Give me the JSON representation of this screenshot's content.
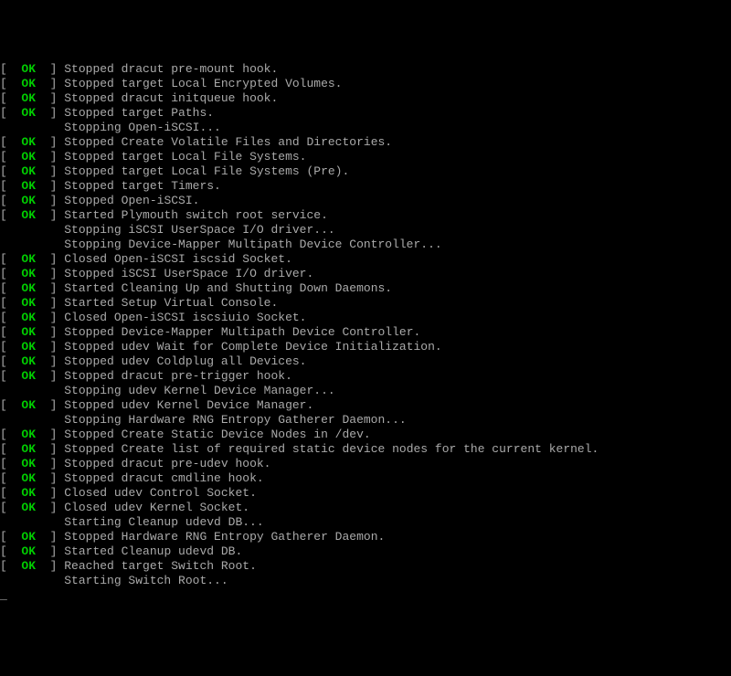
{
  "ok_label": "OK",
  "lines": [
    {
      "status": true,
      "msg": "Stopped dracut pre-mount hook."
    },
    {
      "status": true,
      "msg": "Stopped target Local Encrypted Volumes."
    },
    {
      "status": true,
      "msg": "Stopped dracut initqueue hook."
    },
    {
      "status": true,
      "msg": "Stopped target Paths."
    },
    {
      "status": false,
      "msg": "Stopping Open-iSCSI..."
    },
    {
      "status": true,
      "msg": "Stopped Create Volatile Files and Directories."
    },
    {
      "status": true,
      "msg": "Stopped target Local File Systems."
    },
    {
      "status": true,
      "msg": "Stopped target Local File Systems (Pre)."
    },
    {
      "status": true,
      "msg": "Stopped target Timers."
    },
    {
      "status": true,
      "msg": "Stopped Open-iSCSI."
    },
    {
      "status": true,
      "msg": "Started Plymouth switch root service."
    },
    {
      "status": false,
      "msg": "Stopping iSCSI UserSpace I/O driver..."
    },
    {
      "status": false,
      "msg": "Stopping Device-Mapper Multipath Device Controller..."
    },
    {
      "status": true,
      "msg": "Closed Open-iSCSI iscsid Socket."
    },
    {
      "status": true,
      "msg": "Stopped iSCSI UserSpace I/O driver."
    },
    {
      "status": true,
      "msg": "Started Cleaning Up and Shutting Down Daemons."
    },
    {
      "status": true,
      "msg": "Started Setup Virtual Console."
    },
    {
      "status": true,
      "msg": "Closed Open-iSCSI iscsiuio Socket."
    },
    {
      "status": true,
      "msg": "Stopped Device-Mapper Multipath Device Controller."
    },
    {
      "status": true,
      "msg": "Stopped udev Wait for Complete Device Initialization."
    },
    {
      "status": true,
      "msg": "Stopped udev Coldplug all Devices."
    },
    {
      "status": true,
      "msg": "Stopped dracut pre-trigger hook."
    },
    {
      "status": false,
      "msg": "Stopping udev Kernel Device Manager..."
    },
    {
      "status": true,
      "msg": "Stopped udev Kernel Device Manager."
    },
    {
      "status": false,
      "msg": "Stopping Hardware RNG Entropy Gatherer Daemon..."
    },
    {
      "status": true,
      "msg": "Stopped Create Static Device Nodes in /dev."
    },
    {
      "status": true,
      "msg": "Stopped Create list of required static device nodes for the current kernel."
    },
    {
      "status": true,
      "msg": "Stopped dracut pre-udev hook."
    },
    {
      "status": true,
      "msg": "Stopped dracut cmdline hook."
    },
    {
      "status": true,
      "msg": "Closed udev Control Socket."
    },
    {
      "status": true,
      "msg": "Closed udev Kernel Socket."
    },
    {
      "status": false,
      "msg": "Starting Cleanup udevd DB..."
    },
    {
      "status": true,
      "msg": "Stopped Hardware RNG Entropy Gatherer Daemon."
    },
    {
      "status": true,
      "msg": "Started Cleanup udevd DB."
    },
    {
      "status": true,
      "msg": "Reached target Switch Root."
    },
    {
      "status": false,
      "msg": "Starting Switch Root..."
    }
  ]
}
